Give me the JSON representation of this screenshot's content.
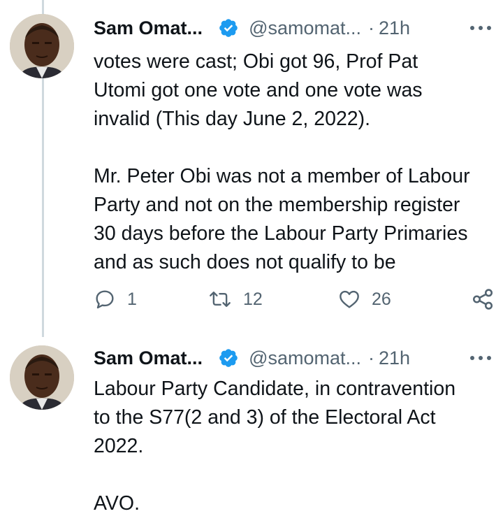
{
  "tweets": [
    {
      "author_name": "Sam Omat...",
      "handle": "@samomat...",
      "separator": "·",
      "time": "21h",
      "lines": [
        "votes were cast; Obi got 96, Prof Pat",
        "Utomi got one vote and one vote was",
        "invalid (This day June 2, 2022).",
        "",
        "Mr. Peter Obi was not a member of Labour",
        "Party and not on the membership register",
        "30 days before the Labour Party Primaries",
        "and as such does not qualify to be"
      ],
      "replies": "1",
      "retweets": "12",
      "likes": "26"
    },
    {
      "author_name": "Sam Omat...",
      "handle": "@samomat...",
      "separator": "·",
      "time": "21h",
      "lines": [
        "Labour Party Candidate, in contravention",
        "to the S77(2 and 3) of the Electoral Act",
        "2022.",
        "",
        "AVO."
      ]
    }
  ],
  "icons": {
    "verified": "verified-badge-icon",
    "more": "more-horizontal-icon",
    "reply": "reply-bubble-icon",
    "retweet": "retweet-icon",
    "like": "heart-icon",
    "share": "share-icon"
  },
  "colors": {
    "verified_blue": "#1d9bf0",
    "secondary_text": "#536471",
    "thread_line": "#cfd9de"
  }
}
